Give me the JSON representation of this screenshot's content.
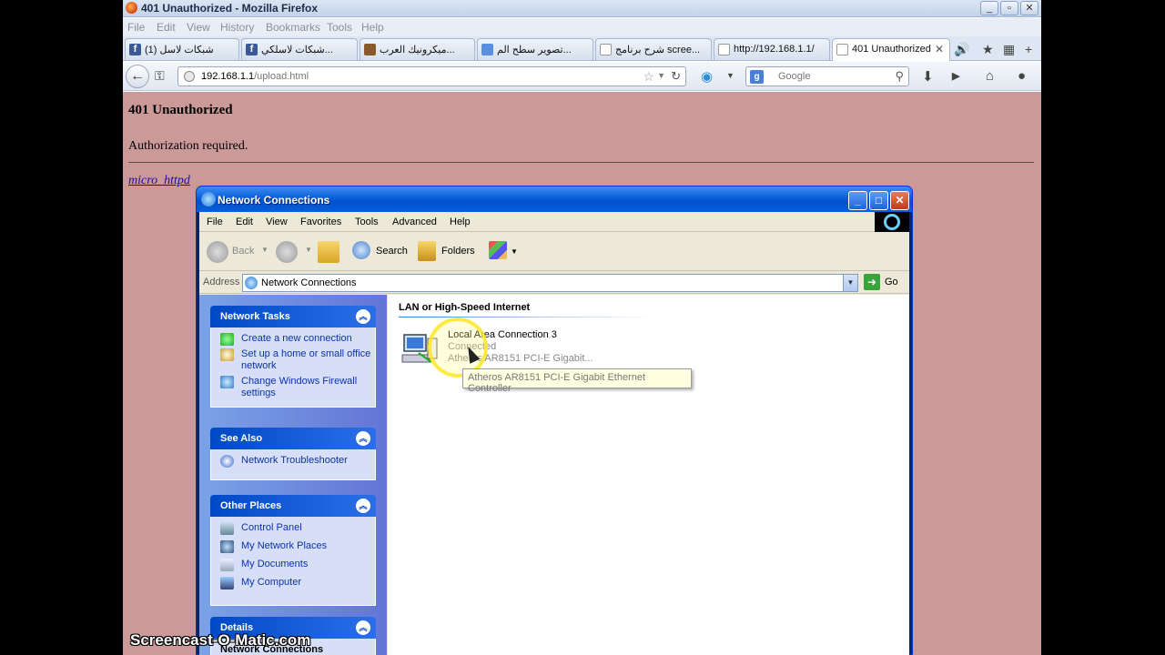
{
  "firefox": {
    "title": "401 Unauthorized - Mozilla Firefox",
    "menu": [
      "File",
      "Edit",
      "View",
      "History",
      "Bookmarks",
      "Tools",
      "Help"
    ],
    "tabs": [
      {
        "label": "شبكات لاسل (1)",
        "icon": "facebook-icon"
      },
      {
        "label": "شبكات لاسلكي...",
        "icon": "facebook-icon"
      },
      {
        "label": "ميكرونيك العرب...",
        "icon": "image-icon"
      },
      {
        "label": "تصوير سطح الم...",
        "icon": "google-icon"
      },
      {
        "label": "شرح برنامج scree...",
        "icon": "document-icon"
      },
      {
        "label": "http://192.168.1.1/",
        "icon": "document-icon"
      },
      {
        "label": "401 Unauthorized",
        "icon": "document-icon",
        "active": true
      }
    ],
    "url_host": "192.168.1.1",
    "url_path": "/upload.html",
    "search_placeholder": "Google"
  },
  "page": {
    "heading": "401 Unauthorized",
    "message": "Authorization required.",
    "link": "micro_httpd",
    "background": "#cc9999"
  },
  "xp_window": {
    "title": "Network Connections",
    "menu": [
      "File",
      "Edit",
      "View",
      "Favorites",
      "Tools",
      "Advanced",
      "Help"
    ],
    "toolbar": {
      "back": "Back",
      "search": "Search",
      "folders": "Folders"
    },
    "address_label": "Address",
    "address_value": "Network Connections",
    "go_label": "Go",
    "network_tasks": {
      "title": "Network Tasks",
      "items": [
        "Create a new connection",
        "Set up a home or small office network",
        "Change Windows Firewall settings"
      ]
    },
    "see_also": {
      "title": "See Also",
      "items": [
        "Network Troubleshooter"
      ]
    },
    "other_places": {
      "title": "Other Places",
      "items": [
        "Control Panel",
        "My Network Places",
        "My Documents",
        "My Computer"
      ]
    },
    "details": {
      "title": "Details",
      "item": "Network Connections"
    },
    "group_title": "LAN or High-Speed Internet",
    "connection": {
      "name": "Local Area Connection 3",
      "status": "Connected",
      "device": "Atheros AR8151 PCI-E Gigabit..."
    },
    "tooltip": "Atheros AR8151 PCI-E Gigabit Ethernet Controller"
  },
  "watermark": "Screencast-O-Matic.com"
}
